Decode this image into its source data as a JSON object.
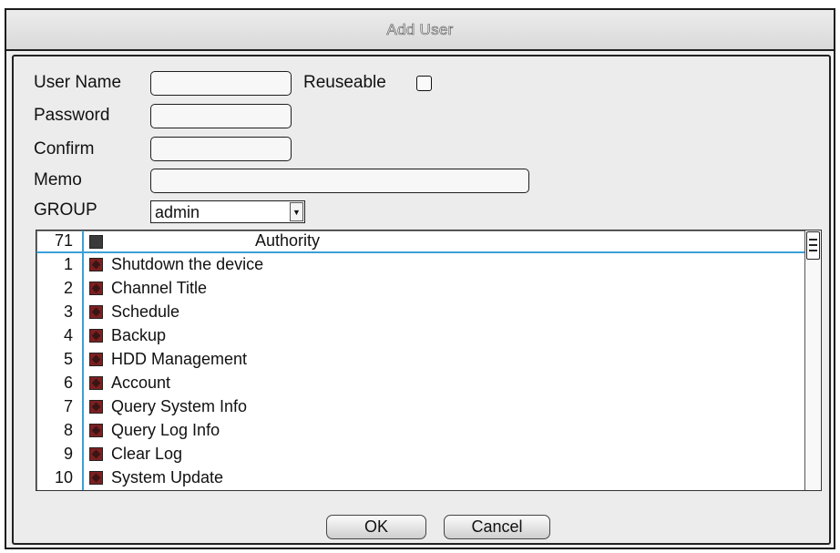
{
  "window": {
    "title": "Add User"
  },
  "form": {
    "user_name_label": "User Name",
    "user_name_value": "",
    "reuseable_label": "Reuseable",
    "reuseable_checked": false,
    "password_label": "Password",
    "password_value": "",
    "confirm_label": "Confirm",
    "confirm_value": "",
    "memo_label": "Memo",
    "memo_value": "",
    "group_label": "GROUP",
    "group_selected": "admin",
    "group_arrow": "▼"
  },
  "authority_list": {
    "header": {
      "count": "71",
      "title": "Authority"
    },
    "rows": [
      {
        "num": "1",
        "label": "Shutdown the device"
      },
      {
        "num": "2",
        "label": "Channel Title"
      },
      {
        "num": "3",
        "label": "Schedule"
      },
      {
        "num": "4",
        "label": "Backup"
      },
      {
        "num": "5",
        "label": "HDD Management"
      },
      {
        "num": "6",
        "label": "Account"
      },
      {
        "num": "7",
        "label": "Query System Info"
      },
      {
        "num": "8",
        "label": "Query Log Info"
      },
      {
        "num": "9",
        "label": "Clear Log"
      },
      {
        "num": "10",
        "label": "System Update"
      }
    ]
  },
  "buttons": {
    "ok": "OK",
    "cancel": "Cancel"
  },
  "colors": {
    "accent_line": "#3aa0d8",
    "checked_square": "#7e1f1f"
  }
}
